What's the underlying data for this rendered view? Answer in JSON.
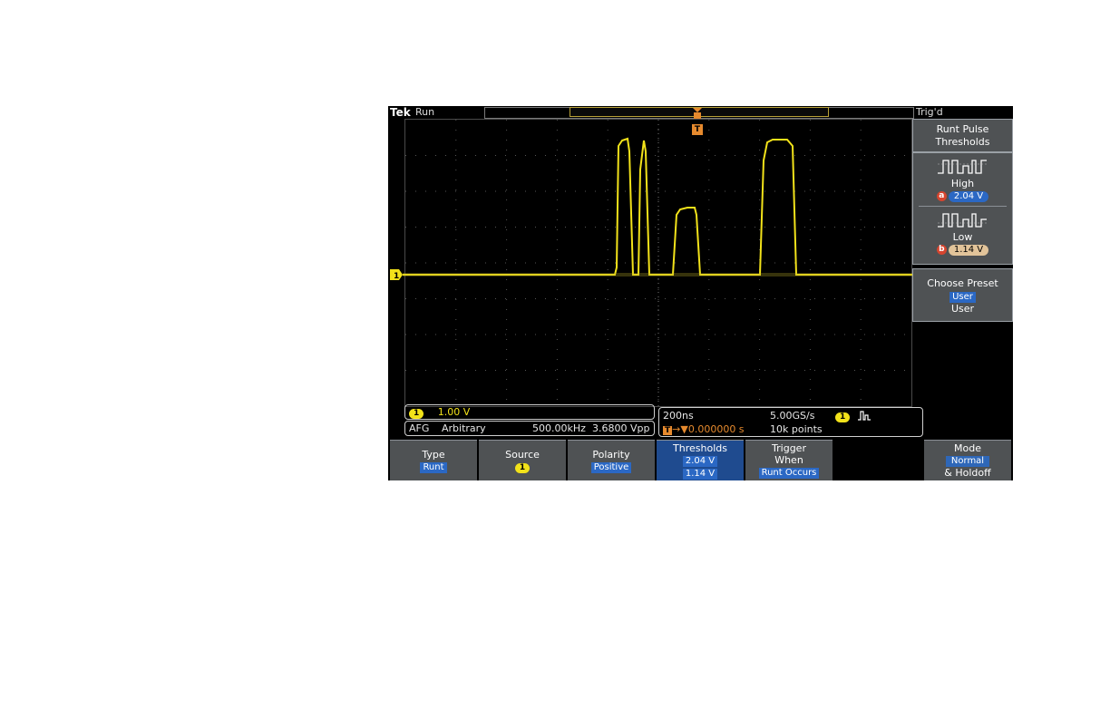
{
  "status": {
    "brand": "Tek",
    "run_state": "Run",
    "trigger_state": "Trig'd"
  },
  "trigger_marker": "T",
  "channel_marker": "1",
  "side_menu": {
    "title_line1": "Runt Pulse",
    "title_line2": "Thresholds",
    "high_label": "High",
    "high_cursor": "a",
    "high_value": "2.04 V",
    "low_label": "Low",
    "low_cursor": "b",
    "low_value": "1.14 V",
    "preset_title": "Choose Preset",
    "preset_selected": "User",
    "preset_value": "User"
  },
  "readout": {
    "ch1_badge": "1",
    "ch1_scale": "1.00 V",
    "afg_label": "AFG",
    "afg_wave": "Arbitrary",
    "afg_freq": "500.00kHz",
    "afg_amp": "3.6800 Vpp",
    "time_div": "200ns",
    "sample_rate": "5.00GS/s",
    "trig_source_badge": "1",
    "trig_delay": "0.000000 s",
    "record_length": "10k points"
  },
  "bottom_menu": [
    {
      "label": "Type",
      "value": "Runt"
    },
    {
      "label": "Source",
      "value": "1"
    },
    {
      "label": "Polarity",
      "value": "Positive"
    },
    {
      "label": "Thresholds",
      "value1": "2.04 V",
      "value2": "1.14 V"
    },
    {
      "label": "Trigger",
      "label2": "When",
      "value": "Runt Occurs"
    },
    {
      "label": "Mode",
      "value": "Normal",
      "label2": "& Holdoff"
    }
  ],
  "colors": {
    "ch1": "#f2e21a",
    "trigger": "#e68a2e",
    "menu_bg": "#4f5254",
    "active_bg": "#1f4b8f",
    "highlight": "#2b68c4"
  },
  "icons": [
    "runt-positive-high-icon",
    "runt-positive-low-icon",
    "pulse-trigger-icon",
    "trigger-t-icon",
    "channel-1-icon"
  ]
}
